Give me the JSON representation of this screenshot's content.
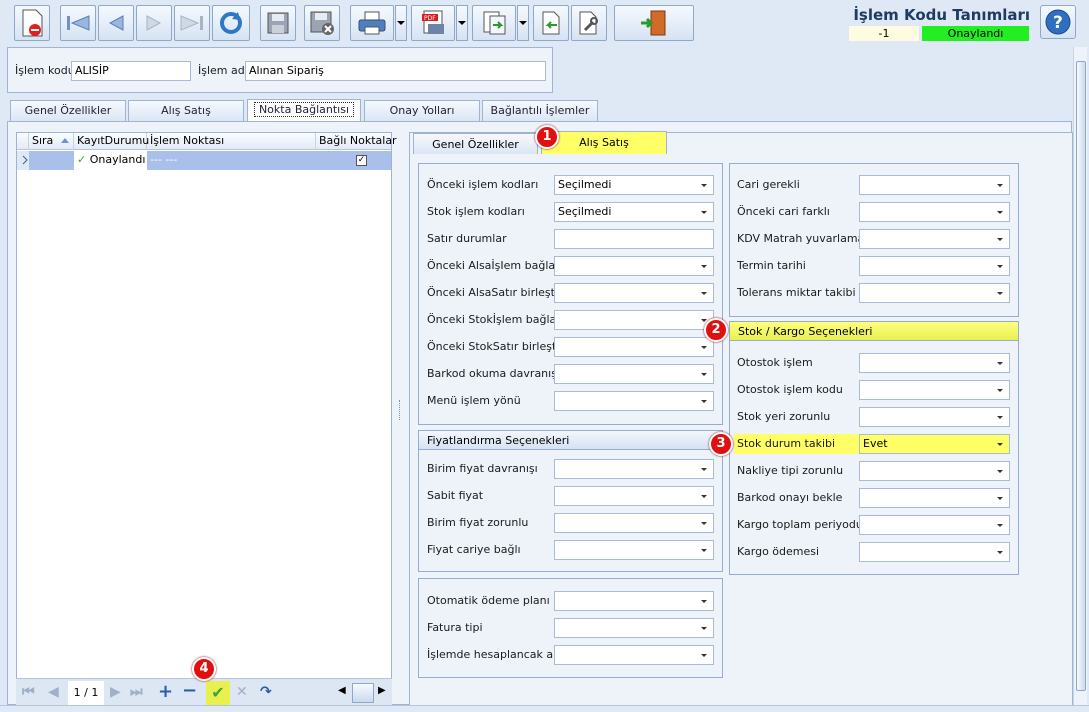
{
  "window": {
    "title": "İşlem Kodu Tanımları",
    "status_number": "-1",
    "status_text": "Onaylandı"
  },
  "header": {
    "code_label": "İşlem kodu",
    "code_value": "ALISİP",
    "name_label": "İşlem adı",
    "name_value": "Alınan Sipariş"
  },
  "main_tabs": [
    "Genel Özellikler",
    "Alış Satış",
    "Nokta Bağlantısı",
    "Onay Yolları",
    "Bağlantılı İşlemler"
  ],
  "grid": {
    "columns": [
      "Sıra",
      "KayıtDurumu",
      "İşlem Noktası",
      "Bağlı Noktalar"
    ],
    "row": {
      "status": "Onaylandı",
      "point": "--- ---"
    },
    "pager": "1 / 1"
  },
  "sub_tabs": [
    "Genel Özellikler",
    "Alış Satış"
  ],
  "left_group": {
    "fields": [
      {
        "label": "Önceki işlem kodları",
        "value": "Seçilmedi"
      },
      {
        "label": "Stok işlem kodları",
        "value": "Seçilmedi"
      },
      {
        "label": "Satır durumlar",
        "value": ""
      },
      {
        "label": "Önceki AlsaİşIem bağla",
        "value": ""
      },
      {
        "label": "Önceki AlsaSatır birleştir",
        "value": ""
      },
      {
        "label": "Önceki Stokİşlem bağla",
        "value": ""
      },
      {
        "label": "Önceki StokSatır birleştir",
        "value": ""
      },
      {
        "label": "Barkod okuma davranışı",
        "value": ""
      },
      {
        "label": "Menü işlem yönü",
        "value": ""
      }
    ]
  },
  "price_group": {
    "title": "Fiyatlandırma Seçenekleri",
    "fields": [
      {
        "label": "Birim fiyat davranışı",
        "value": ""
      },
      {
        "label": "Sabit fiyat",
        "value": ""
      },
      {
        "label": "Birim fiyat zorunlu",
        "value": ""
      },
      {
        "label": "Fiyat cariye bağlı",
        "value": ""
      }
    ]
  },
  "payment_group": {
    "fields": [
      {
        "label": "Otomatik ödeme planı",
        "value": ""
      },
      {
        "label": "Fatura tipi",
        "value": ""
      },
      {
        "label": "İşlemde hesaplancak alan",
        "value": ""
      }
    ]
  },
  "right_top_group": {
    "fields": [
      {
        "label": "Cari gerekli",
        "value": ""
      },
      {
        "label": "Önceki cari farklı",
        "value": ""
      },
      {
        "label": "KDV Matrah yuvarlaması",
        "value": ""
      },
      {
        "label": "Termin tarihi",
        "value": ""
      },
      {
        "label": "Tolerans miktar takibi",
        "value": ""
      }
    ]
  },
  "stock_group": {
    "title": "Stok / Kargo Seçenekleri",
    "fields": [
      {
        "label": "Otostok işlem",
        "value": ""
      },
      {
        "label": "Otostok işlem kodu",
        "value": ""
      },
      {
        "label": "Stok yeri zorunlu",
        "value": ""
      },
      {
        "label": "Stok durum takibi",
        "value": "Evet"
      },
      {
        "label": "Nakliye tipi zorunlu",
        "value": ""
      },
      {
        "label": "Barkod onayı bekle",
        "value": ""
      },
      {
        "label": "Kargo toplam periyodu",
        "value": ""
      },
      {
        "label": "Kargo ödemesi",
        "value": ""
      }
    ]
  },
  "badges": [
    "1",
    "2",
    "3",
    "4"
  ],
  "colors": {
    "highlight": "#ffff66",
    "approved": "#22ee22",
    "badge": "#e01010"
  }
}
